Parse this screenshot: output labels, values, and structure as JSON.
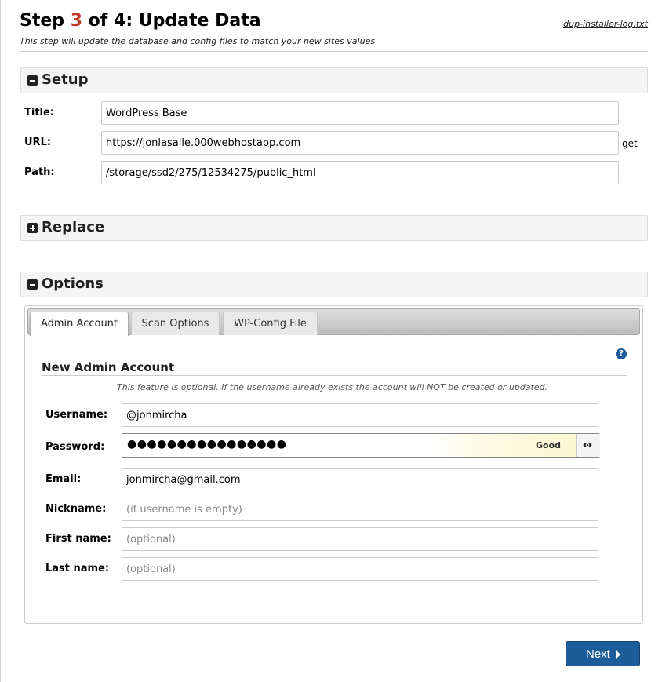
{
  "header": {
    "step_prefix": "Step ",
    "step_number": "3",
    "step_suffix": " of 4: Update Data",
    "subtitle": "This step will update the database and config files to match your new sites values.",
    "log_link": "dup-installer-log.txt"
  },
  "setup": {
    "title": "Setup",
    "fields": {
      "title_label": "Title:",
      "title_value": "WordPress Base",
      "url_label": "URL:",
      "url_value": "https://jonlasalle.000webhostapp.com",
      "path_label": "Path:",
      "path_value": "/storage/ssd2/275/12534275/public_html"
    },
    "get_link": "get"
  },
  "replace": {
    "title": "Replace"
  },
  "options": {
    "title": "Options",
    "tabs": [
      "Admin Account",
      "Scan Options",
      "WP-Config File"
    ],
    "active_tab": "Admin Account",
    "admin": {
      "heading": "New Admin Account",
      "note": "This feature is optional. If the username already exists the account will NOT be created or updated.",
      "username_label": "Username:",
      "username_value": "@jonmircha",
      "password_label": "Password:",
      "password_dots": "●●●●●●●●●●●●●●●●",
      "password_strength": "Good",
      "email_label": "Email:",
      "email_value": "jonmircha@gmail.com",
      "nickname_label": "Nickname:",
      "nickname_placeholder": "(if username is empty)",
      "firstname_label": "First name:",
      "firstname_placeholder": "(optional)",
      "lastname_label": "Last name:",
      "lastname_placeholder": "(optional)"
    }
  },
  "footer": {
    "next_label": "Next"
  },
  "icons": {
    "setup_toggle": "minus-square-icon",
    "replace_toggle": "plus-square-icon",
    "options_toggle": "minus-square-icon",
    "help": "question-circle-icon",
    "show_password": "eye-icon",
    "next_arrow": "caret-right-icon"
  },
  "colors": {
    "step_number": "#c0392b",
    "primary_button": "#1c5c99",
    "help_icon": "#1c5c99",
    "section_bar": "#f4f4f4"
  }
}
